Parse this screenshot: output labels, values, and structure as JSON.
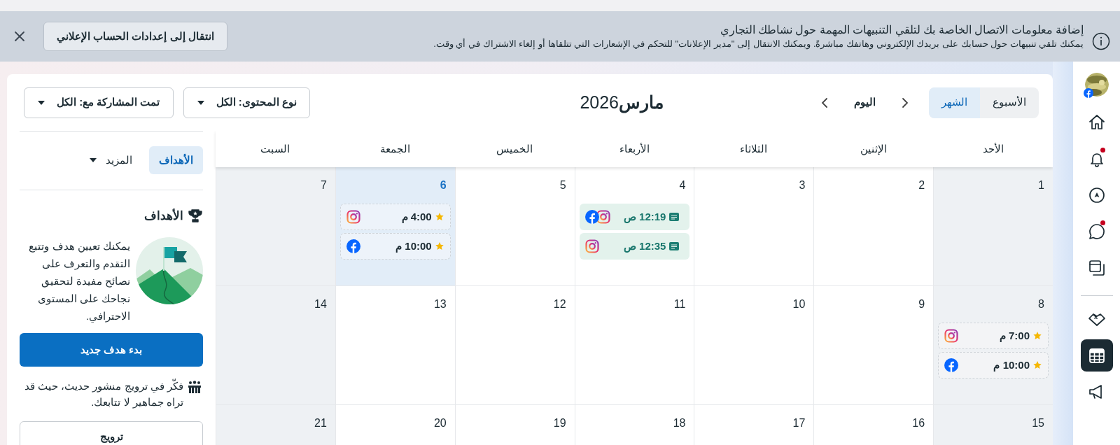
{
  "banner": {
    "title": "إضافة معلومات الاتصال الخاصة بك لتلقي التنبيهات المهمة حول نشاطك التجاري",
    "body": "يمكنك تلقي تنبيهات حول حسابك على بريدك الإلكتروني وهاتفك مباشرةً. ويمكنك الانتقال إلى \"مدير الإعلانات\" للتحكم في الإشعارات التي تتلقاها أو إلغاء الاشتراك في أي وقت.",
    "action": "انتقال إلى إعدادات الحساب الإعلاني"
  },
  "rail": [
    {
      "notification": false,
      "selected": false
    },
    {
      "notification": true,
      "selected": false
    },
    {
      "notification": false,
      "selected": false
    },
    {
      "notification": true,
      "selected": false
    },
    {
      "notification": false,
      "selected": false
    },
    {
      "notification": false,
      "selected": false
    },
    {
      "notification": false,
      "selected": true
    },
    {
      "notification": false,
      "selected": false
    }
  ],
  "toolbar": {
    "views": [
      {
        "label": "الأسبوع",
        "selected": false
      },
      {
        "label": "الشهر",
        "selected": true
      }
    ],
    "today": "اليوم",
    "month_title": "**مارس**2026",
    "filters": [
      "نوع المحتوى: الكل",
      "تمت المشاركة مع: الكل"
    ]
  },
  "side_tabs": [
    {
      "label": "الأهداف",
      "selected": true,
      "dropdown": false
    },
    {
      "label": "المزيد",
      "selected": false,
      "dropdown": true
    }
  ],
  "goals": {
    "heading": "الأهداف",
    "description": "يمكنك تعيين هدف وتتبع التقدم والتعرف على نصائح مفيدة لتحقيق نجاحك على المستوى الاحترافي.",
    "button": "بدء هدف جديد",
    "tip": "فكّر في ترويج منشور حديث، حيث قد تراه جماهير لا تتابعك.",
    "promote_button": "ترويج"
  },
  "calendar": {
    "weekdays": [
      "الأحد",
      "الإثنين",
      "الثلاثاء",
      "الأربعاء",
      "الخميس",
      "الجمعة",
      "السبت"
    ],
    "weeks": [
      [
        {
          "day": "1",
          "shaded": true,
          "today": false
        },
        {
          "day": "2",
          "shaded": false,
          "today": false
        },
        {
          "day": "3",
          "shaded": false,
          "today": false
        },
        {
          "day": "4",
          "shaded": false,
          "today": false,
          "events": [
            {
              "kind": "published",
              "time": "12:19 ص",
              "platforms": [
                {
                  "kind": "instagram"
                },
                {
                  "kind": "facebook"
                }
              ]
            },
            {
              "kind": "published",
              "time": "12:35 ص",
              "platforms": [
                {
                  "kind": "instagram"
                }
              ]
            }
          ]
        },
        {
          "day": "5",
          "shaded": false,
          "today": false
        },
        {
          "day": "6",
          "today": true,
          "events": [
            {
              "kind": "suggested",
              "time": "4:00 م",
              "platforms": [
                {
                  "kind": "instagram"
                }
              ]
            },
            {
              "kind": "suggested",
              "time": "10:00 م",
              "platforms": [
                {
                  "kind": "facebook"
                }
              ]
            }
          ]
        },
        {
          "day": "7",
          "shaded": true,
          "today": false
        }
      ],
      [
        {
          "day": "8",
          "shaded": true,
          "today": false,
          "events": [
            {
              "kind": "suggested",
              "time": "7:00 م",
              "platforms": [
                {
                  "kind": "instagram"
                }
              ]
            },
            {
              "kind": "suggested",
              "time": "10:00 م",
              "platforms": [
                {
                  "kind": "facebook"
                }
              ]
            }
          ]
        },
        {
          "day": "9",
          "shaded": false,
          "today": false
        },
        {
          "day": "10",
          "shaded": false,
          "today": false
        },
        {
          "day": "11",
          "shaded": false,
          "today": false
        },
        {
          "day": "12",
          "shaded": false,
          "today": false
        },
        {
          "day": "13",
          "shaded": false,
          "today": false
        },
        {
          "day": "14",
          "shaded": true,
          "today": false
        }
      ],
      [
        {
          "day": "15",
          "shaded": true,
          "today": false
        },
        {
          "day": "16",
          "shaded": false,
          "today": false
        },
        {
          "day": "17",
          "shaded": false,
          "today": false
        },
        {
          "day": "18",
          "shaded": false,
          "today": false
        },
        {
          "day": "19",
          "shaded": false,
          "today": false
        },
        {
          "day": "20",
          "shaded": false,
          "today": false
        },
        {
          "day": "21",
          "shaded": true,
          "today": false
        }
      ]
    ]
  }
}
